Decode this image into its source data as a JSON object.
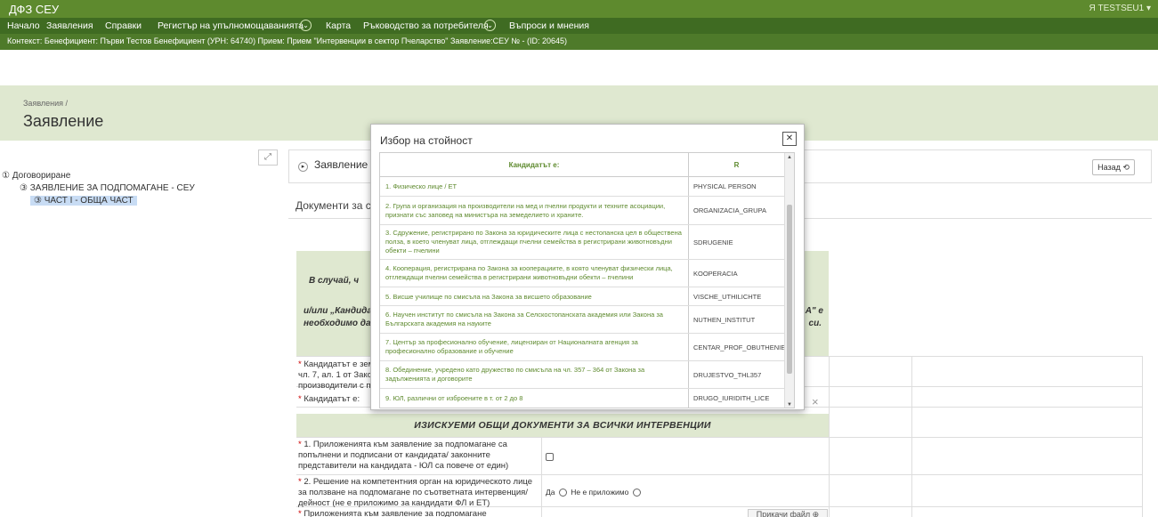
{
  "app": {
    "title": "ДФЗ СЕУ",
    "user": "Я TESTSEU1 ▾"
  },
  "nav": {
    "items": [
      "Начало",
      "Заявления",
      "Справки",
      "Регистър на упълномощаванията",
      "Карта",
      "Ръководство за потребителя",
      "Въпроси и мнения"
    ]
  },
  "context": {
    "text": "Контекст: Бенефициент: Първи Тестов Бенефициент (УРН: 64740) Прием: Прием \"Интервенции в сектор Пчеларство\" Заявление:СЕУ № - (ID: 20645)"
  },
  "breadcrumb": "Заявления /",
  "page_title": "Заявление",
  "tree": {
    "n1": "① Договориране",
    "n2": "③ ЗАЯВЛЕНИЕ ЗА ПОДПОМАГАНЕ - СЕУ",
    "n3": "③ ЧАСТ I - ОБЩА ЧАСТ"
  },
  "panel": {
    "title": "Заявление",
    "back_label": "Назад ⟲"
  },
  "docs_heading": "Документи за схе",
  "notice": {
    "l1": "В случай, ч",
    "l2": "и/или „Кандидат",
    "l3": "необходимо да",
    "r1": "А\" е",
    "r2": "си."
  },
  "form": {
    "q_farmer": "Кандидатът е зем\nчл. 7, ал. 1 от Зако\nпроизводители с п",
    "q_candidate": "Кандидатът е:",
    "section": "ИЗИСКУЕМИ ОБЩИ ДОКУМЕНТИ ЗА ВСИЧКИ ИНТЕРВЕНЦИИ",
    "q1": "1. Приложенията към заявление за подпомагане са\nпопълнени и подписани от кандидата/ законните\nпредставители на кандидата - ЮЛ са повече от един)",
    "q2": "2. Решение на компетентния орган на юридическото лице\nза ползване на подпомагане по съответната интервенция/\nдейност (не е приложимо за кандидати ФЛ и ЕТ)",
    "q2_yes": "Да",
    "q2_na": "Не е приложимо",
    "q3": "Приложенията към заявление за подпомагане",
    "file_btn": "Прикачи файл ⊕"
  },
  "modal": {
    "title": "Избор на стойност",
    "col_desc": "Кандидатът е:",
    "col_code": "R",
    "rows": [
      {
        "desc": "1. Физическо лице / ЕТ",
        "code": "PHYSICAL PERSON"
      },
      {
        "desc": "2. Група и организация на производители на мед и пчелни продукти и техните асоциации, признати със заповед на министъра на земеделието и храните.",
        "code": "ORGANIZACIA_GRUPA"
      },
      {
        "desc": "3. Сдружение, регистрирано по Закона за юридическите лица с нестопанска цел в обществена полза, в което членуват лица, отглеждащи пчелни семейства в регистрирани животновъдни обекти – пчелини",
        "code": "SDRUGENIE"
      },
      {
        "desc": "4. Кооперация, регистрирана по Закона за кооперациите, в която членуват физически лица, отглеждащи пчелни семейства в регистрирани животновъдни обекти – пчелини",
        "code": "KOOPERACIA"
      },
      {
        "desc": "5. Висше училище по смисъла на Закона за висшето образование",
        "code": "VISCHE_UTHILICHTE"
      },
      {
        "desc": "6. Научен институт по смисъла на Закона за Селскостопанската академия или Закона за Българската академия на науките",
        "code": "NUTHEN_INSTITUT"
      },
      {
        "desc": "7. Център за професионално обучение, лицензиран от Националната агенция за професионално образование и обучение",
        "code": "CENTAR_PROF_OBUTHENIE"
      },
      {
        "desc": "8. Обединение, учредено като дружество по смисъла на чл. 357 – 364 от Закона за задълженията и договорите",
        "code": "DRUJESTVO_THL357"
      },
      {
        "desc": "9. ЮЛ, различни от изброените в т. от 2 до 8",
        "code": "DRUGO_IURIDITH_LICE"
      }
    ]
  }
}
